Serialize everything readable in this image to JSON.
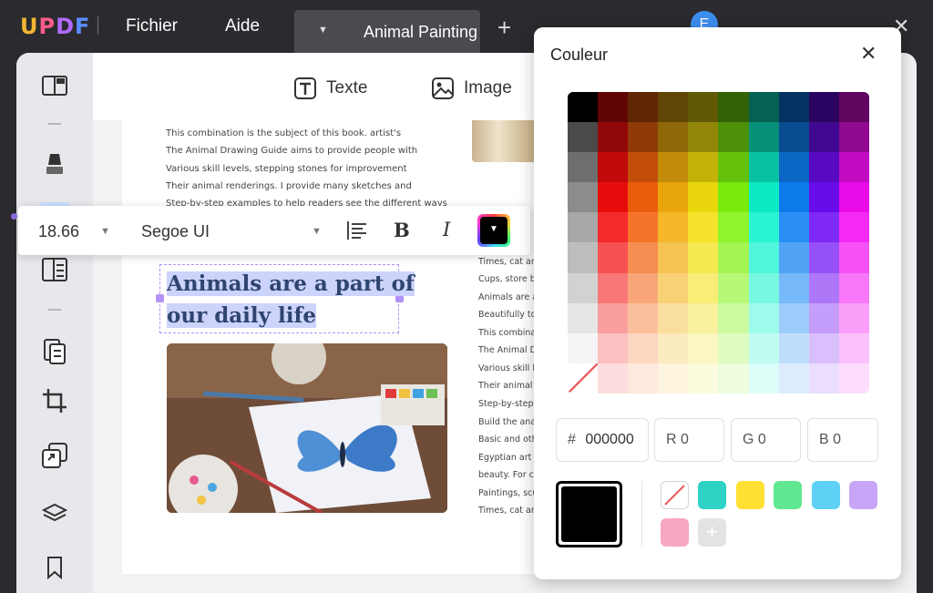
{
  "app": {
    "logo": "UPDF",
    "menu": [
      "Fichier",
      "Aide"
    ],
    "tab_title": "Animal Painting",
    "avatar_initial": "E"
  },
  "toolbar": {
    "text_label": "Texte",
    "image_label": "Image"
  },
  "format_bar": {
    "font_size": "18.66",
    "font_family": "Segoe UI",
    "bold_label": "B",
    "italic_label": "I"
  },
  "page": {
    "body_lines": [
      "This combination is the subject of this book. artist's",
      "The Animal Drawing Guide aims to provide people with",
      "Various skill levels, stepping stones for improvement",
      "Their animal renderings. I provide many sketches and",
      "Step-by-step examples to help readers see the different ways"
    ],
    "heading_line1": "Animals are a part of",
    "heading_line2": "our daily life",
    "right_column": [
      "Times, cat an",
      "Cups, store b",
      "Animals are a",
      "Beautifully to",
      "This combina",
      "The Animal D",
      "Various skill l",
      "Their animal",
      "Step-by-step",
      "Build the ana",
      "Basic and oth",
      "Egyptian art c",
      "beauty. For c",
      "Paintings, scu",
      "Times, cat an"
    ]
  },
  "color_panel": {
    "title": "Couleur",
    "hex_prefix": "#",
    "hex_value": "000000",
    "r_label": "R 0",
    "g_label": "G 0",
    "b_label": "B 0",
    "current_color": "#000000",
    "recent_colors": [
      "#2ed3c6",
      "#ffe033",
      "#5fe891",
      "#5ed1f5",
      "#c8a5f7",
      "#f7a6c4"
    ]
  }
}
